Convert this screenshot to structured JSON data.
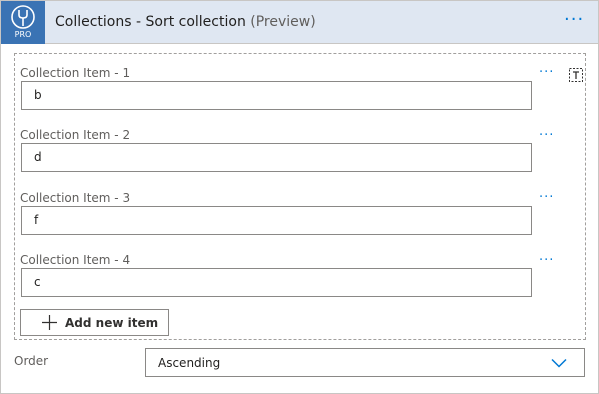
{
  "header": {
    "logo_text": "PRO",
    "title": "Collections - Sort collection",
    "preview": "(Preview)",
    "more_icon": "ellipsis-icon"
  },
  "collection": {
    "items": [
      {
        "label": "Collection Item - 1",
        "value": "b"
      },
      {
        "label": "Collection Item - 2",
        "value": "d"
      },
      {
        "label": "Collection Item - 3",
        "value": "f"
      },
      {
        "label": "Collection Item - 4",
        "value": "c"
      }
    ],
    "item_more_icon": "ellipsis-icon",
    "text_mode_icon": "text-mode-icon",
    "add_label": "Add new item"
  },
  "order": {
    "label": "Order",
    "value": "Ascending"
  },
  "colors": {
    "header_bg": "#dfe7f2",
    "logo_bg": "#3a73b4",
    "accent": "#0078d4"
  }
}
